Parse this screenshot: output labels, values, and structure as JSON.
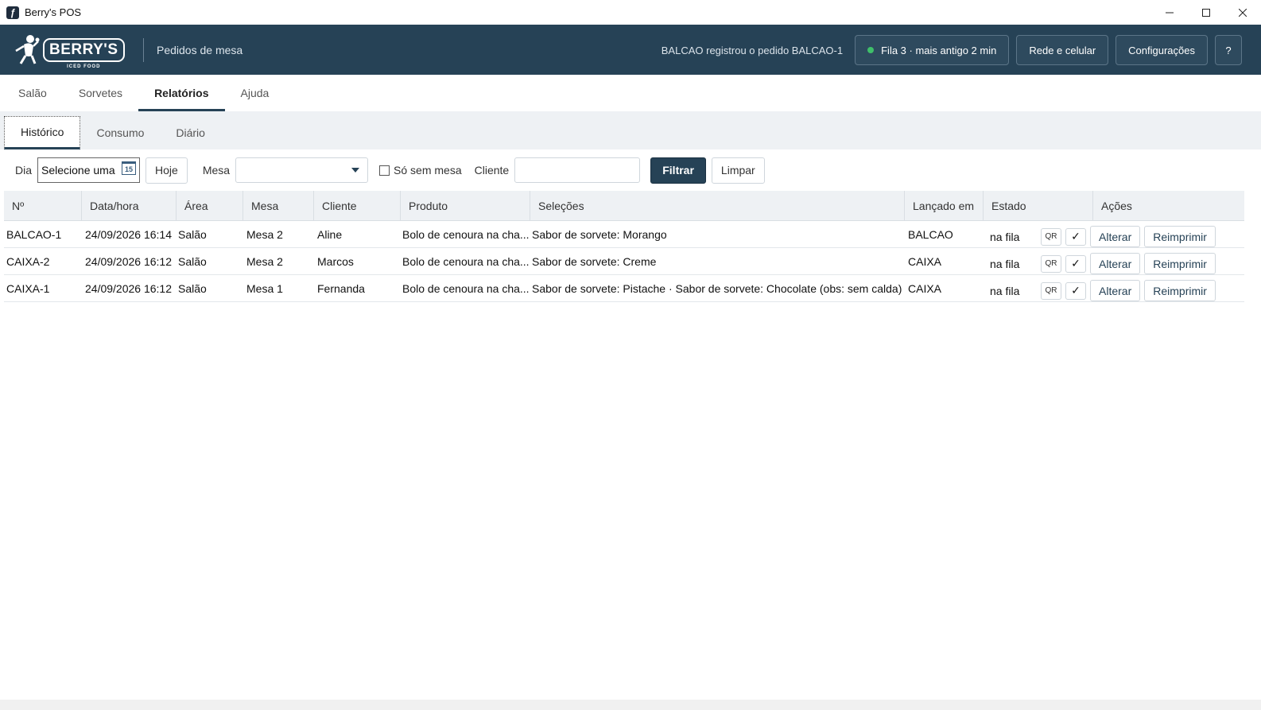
{
  "window": {
    "title": "Berry's POS",
    "app_icon": "app-icon"
  },
  "header": {
    "logo_text": "BERRY'S",
    "logo_sub": "ICED FOOD",
    "subtitle": "Pedidos de mesa",
    "status_text": "BALCAO registrou o pedido BALCAO-1",
    "queue_label": "Fila 3 · mais antigo 2 min",
    "queue_status_color": "#3fbf6a",
    "network_label": "Rede e celular",
    "settings_label": "Configurações",
    "help_label": "?"
  },
  "main_tabs": [
    {
      "label": "Salão",
      "active": false
    },
    {
      "label": "Sorvetes",
      "active": false
    },
    {
      "label": "Relatórios",
      "active": true
    },
    {
      "label": "Ajuda",
      "active": false
    }
  ],
  "sub_tabs": [
    {
      "label": "Histórico",
      "active": true
    },
    {
      "label": "Consumo",
      "active": false
    },
    {
      "label": "Diário",
      "active": false
    }
  ],
  "filters": {
    "day_label": "Dia",
    "day_value": "Selecione uma",
    "calendar_icon_text": "15",
    "today_label": "Hoje",
    "table_label": "Mesa",
    "table_value": "",
    "no_table_label": "Só sem mesa",
    "no_table_checked": false,
    "client_label": "Cliente",
    "client_value": "",
    "filter_label": "Filtrar",
    "clear_label": "Limpar"
  },
  "table": {
    "columns": [
      "Nº",
      "Data/hora",
      "Área",
      "Mesa",
      "Cliente",
      "Produto",
      "Seleções",
      "Lançado em",
      "Estado",
      "Ações"
    ],
    "rows": [
      {
        "num": "BALCAO-1",
        "datetime": "24/09/2026 16:14",
        "area": "Salão",
        "mesa": "Mesa 2",
        "cliente": "Aline",
        "produto": "Bolo de cenoura na cha...",
        "selecoes": "Sabor de sorvete: Morango",
        "lancado": "BALCAO",
        "estado": "na fila"
      },
      {
        "num": "CAIXA-2",
        "datetime": "24/09/2026 16:12",
        "area": "Salão",
        "mesa": "Mesa 2",
        "cliente": "Marcos",
        "produto": "Bolo de cenoura na cha...",
        "selecoes": "Sabor de sorvete: Creme",
        "lancado": "CAIXA",
        "estado": "na fila"
      },
      {
        "num": "CAIXA-1",
        "datetime": "24/09/2026 16:12",
        "area": "Salão",
        "mesa": "Mesa 1",
        "cliente": "Fernanda",
        "produto": "Bolo de cenoura na cha...",
        "selecoes": "Sabor de sorvete: Pistache · Sabor de sorvete: Chocolate (obs: sem calda)",
        "lancado": "CAIXA",
        "estado": "na fila"
      }
    ],
    "actions": {
      "qr_label": "QR",
      "confirm_label": "✓",
      "alter_label": "Alterar",
      "reprint_label": "Reimprimir"
    }
  },
  "colors": {
    "header_bg": "#264256",
    "accent": "#264256",
    "status_dot": "#3fbf6a"
  }
}
